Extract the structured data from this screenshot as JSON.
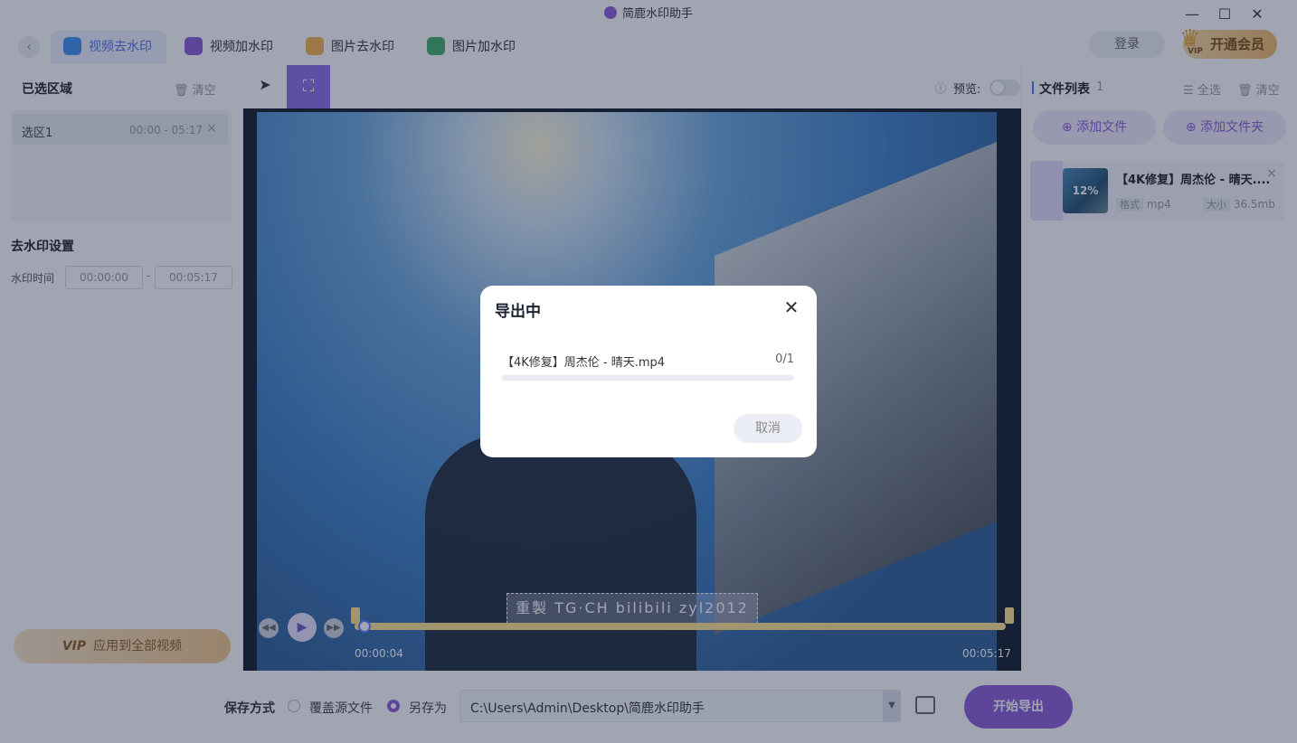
{
  "app": {
    "title": "简鹿水印助手"
  },
  "window": {
    "minimize": "—",
    "maximize": "☐",
    "close": "✕"
  },
  "tabs": [
    {
      "label": "视频去水印",
      "icon": "video-remove-icon",
      "active": true,
      "color": "#3d8ef0"
    },
    {
      "label": "视频加水印",
      "icon": "video-add-icon",
      "active": false,
      "color": "#8a5ad8"
    },
    {
      "label": "图片去水印",
      "icon": "image-remove-icon",
      "active": false,
      "color": "#f5b54a"
    },
    {
      "label": "图片加水印",
      "icon": "image-add-icon",
      "active": false,
      "color": "#3fae6b"
    }
  ],
  "header": {
    "back": "‹",
    "login": "登录",
    "vip": "开通会员",
    "vip_badge": "VIP"
  },
  "left": {
    "selected_regions_title": "已选区域",
    "clear": "清空",
    "regions": [
      {
        "name": "选区1",
        "range": "00:00 - 05:17"
      }
    ],
    "settings_title": "去水印设置",
    "watermark_time_label": "水印时间",
    "time_start": "00:00:00",
    "time_sep": "-",
    "time_end": "00:05:17",
    "vip_apply_badge": "VIP",
    "vip_apply": "应用到全部视频"
  },
  "toolbar": {
    "preview_label": "预览:"
  },
  "player": {
    "current_time": "00:00:04",
    "total_time": "00:05:17",
    "progress": 0.0126,
    "watermark_text": "重製  TG·CH  bilibili  zyl2012"
  },
  "right": {
    "title": "文件列表",
    "count": "1",
    "select_all": "全选",
    "clear": "清空",
    "add_file": "添加文件",
    "add_folder": "添加文件夹",
    "files": [
      {
        "name": "【4K修复】周杰伦 - 晴天....",
        "progress_text": "12%",
        "format_label": "格式",
        "format": "mp4",
        "size_label": "大小",
        "size": "36.5mb"
      }
    ]
  },
  "bottom": {
    "save_mode_label": "保存方式",
    "overwrite": "覆盖源文件",
    "save_as": "另存为",
    "selected": "save_as",
    "path": "C:\\Users\\Admin\\Desktop\\简鹿水印助手",
    "export": "开始导出"
  },
  "dialog": {
    "title": "导出中",
    "file": "【4K修复】周杰伦 - 晴天.mp4",
    "count": "0/1",
    "progress": 0,
    "cancel": "取消"
  },
  "colors": {
    "accent": "#8a5ad8",
    "tab_active": "#4f6ee8",
    "timeline": "#ffe58a"
  }
}
